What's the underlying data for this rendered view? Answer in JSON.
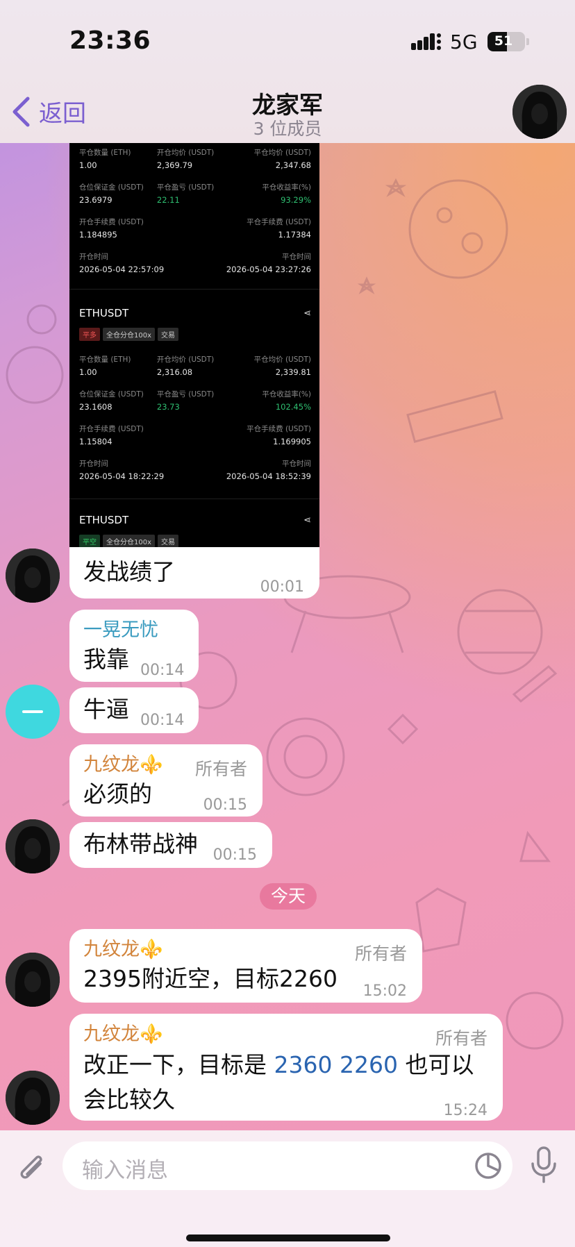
{
  "status_bar": {
    "time": "23:36",
    "network": "5G",
    "battery": "51",
    "battery_level": 0.51
  },
  "header": {
    "back_label": "返回",
    "title": "龙家军",
    "subtitle": "3 位成员"
  },
  "trade_screenshot": {
    "card1": {
      "row1": [
        [
          "平仓数量 (ETH)",
          "1.00"
        ],
        [
          "开仓均价 (USDT)",
          "2,369.79"
        ],
        [
          "平仓均价 (USDT)",
          "2,347.68"
        ]
      ],
      "row2": [
        [
          "仓位保证金 (USDT)",
          "23.6979"
        ],
        [
          "平仓盈亏 (USDT)",
          "22.11"
        ],
        [
          "平仓收益率(%)",
          "93.29%"
        ]
      ],
      "row3": [
        [
          "开仓手续费 (USDT)",
          "1.184895"
        ],
        [
          "平仓手续费 (USDT)",
          "1.17384"
        ]
      ],
      "row4": [
        [
          "开仓时间",
          "2026-05-04 22:57:09"
        ],
        [
          "平仓时间",
          "2026-05-04 23:27:26"
        ]
      ]
    },
    "card2": {
      "symbol": "ETHUSDT",
      "tags": [
        "平多",
        "全仓分仓100x",
        "交易"
      ],
      "row1": [
        [
          "平仓数量 (ETH)",
          "1.00"
        ],
        [
          "开仓均价 (USDT)",
          "2,316.08"
        ],
        [
          "平仓均价 (USDT)",
          "2,339.81"
        ]
      ],
      "row2": [
        [
          "仓位保证金 (USDT)",
          "23.1608"
        ],
        [
          "平仓盈亏 (USDT)",
          "23.73"
        ],
        [
          "平仓收益率(%)",
          "102.45%"
        ]
      ],
      "row3": [
        [
          "开仓手续费 (USDT)",
          "1.15804"
        ],
        [
          "平仓手续费 (USDT)",
          "1.169905"
        ]
      ],
      "row4": [
        [
          "开仓时间",
          "2026-05-04 18:22:29"
        ],
        [
          "平仓时间",
          "2026-05-04 18:52:39"
        ]
      ]
    },
    "card3": {
      "symbol": "ETHUSDT",
      "tags": [
        "平空",
        "全仓分仓100x",
        "交易"
      ]
    }
  },
  "messages": [
    {
      "text": "发战绩了",
      "time": "00:01"
    },
    {
      "sender": "一晃无忧",
      "text": "我靠",
      "time": "00:14"
    },
    {
      "text": "牛逼",
      "time": "00:14"
    },
    {
      "sender": "九纹龙⚜️",
      "role": "所有者",
      "text": "必须的",
      "time": "00:15"
    },
    {
      "text": "布林带战神",
      "time": "00:15"
    },
    {
      "sender": "九纹龙⚜️",
      "role": "所有者",
      "text": "2395附近空，目标2260",
      "time": "15:02"
    },
    {
      "sender": "九纹龙⚜️",
      "role": "所有者",
      "text_a": "改正一下，目标是 ",
      "text_link": "2360 2260",
      "text_b": " 也可以",
      "text_line2": "会比较久",
      "time": "15:24"
    }
  ],
  "date_separator": "今天",
  "composer": {
    "placeholder": "输入消息"
  }
}
